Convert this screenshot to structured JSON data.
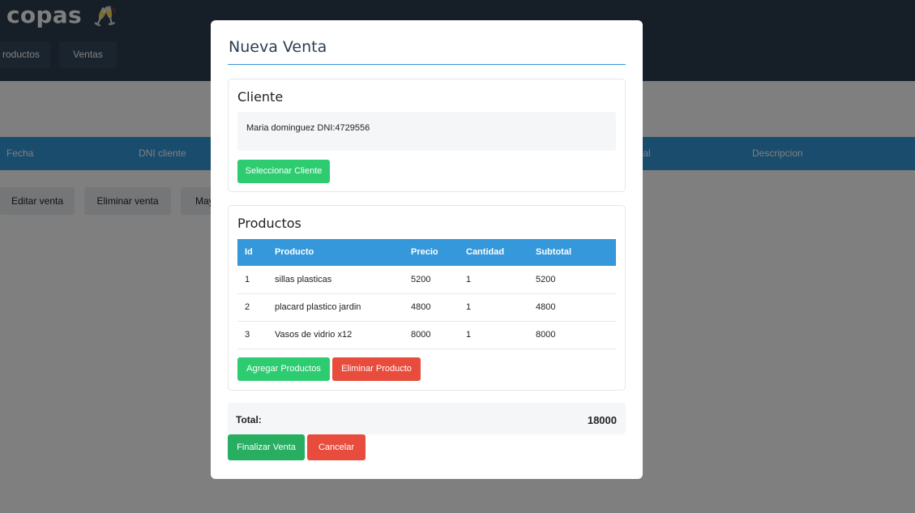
{
  "app": {
    "brand": "copas",
    "brand_icon": "🥂",
    "nav": [
      "roductos",
      "Ventas"
    ]
  },
  "sales_table": {
    "headers": [
      "Fecha",
      "DNI cliente",
      "tal",
      "Descripcion"
    ]
  },
  "actions": [
    "Editar venta",
    "Eliminar venta",
    "May"
  ],
  "modal": {
    "title": "Nueva Venta",
    "client": {
      "title": "Cliente",
      "selected": "Maria dominguez DNI:4729556",
      "select_button": "Seleccionar Cliente"
    },
    "products": {
      "title": "Productos",
      "columns": [
        "Id",
        "Producto",
        "Precio",
        "Cantidad",
        "Subtotal"
      ],
      "rows": [
        {
          "id": "1",
          "producto": "sillas plasticas",
          "precio": "5200",
          "cantidad": "1",
          "subtotal": "5200"
        },
        {
          "id": "2",
          "producto": "placard plastico jardin",
          "precio": "4800",
          "cantidad": "1",
          "subtotal": "4800"
        },
        {
          "id": "3",
          "producto": "Vasos de vidrio x12",
          "precio": "8000",
          "cantidad": "1",
          "subtotal": "8000"
        }
      ],
      "add_button": "Agregar Productos",
      "remove_button": "Eliminar Producto"
    },
    "total": {
      "label": "Total:",
      "value": "18000"
    },
    "finalize_button": "Finalizar Venta",
    "cancel_button": "Cancelar"
  },
  "colors": {
    "primary": "#3498db",
    "success": "#2ecc71",
    "danger": "#e74c3c",
    "header": "#2c3e50"
  }
}
